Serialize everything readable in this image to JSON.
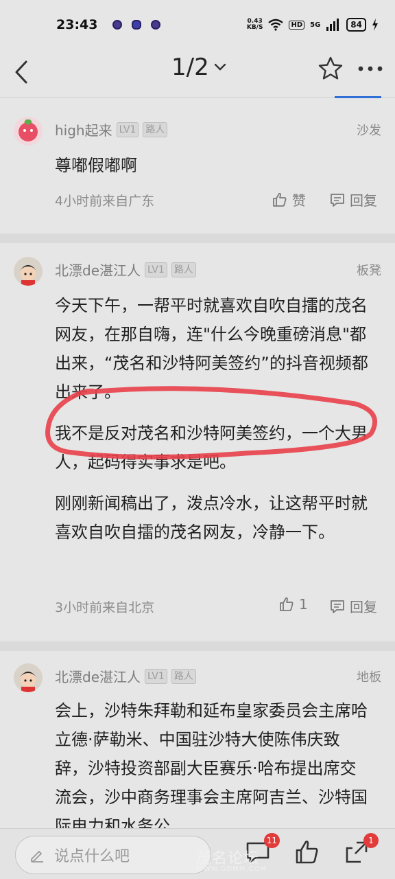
{
  "status_bar": {
    "time": "23:43",
    "net_speed_value": "0.43",
    "net_speed_unit": "KB/S",
    "hd": "HD",
    "signal": "5G",
    "battery": "84"
  },
  "nav": {
    "page_indicator": "1/2"
  },
  "comments": [
    {
      "username": "high起来",
      "level": "LV1",
      "role": "路人",
      "floor": "沙发",
      "paragraphs": [
        "尊嘟假嘟啊"
      ],
      "meta": "4小时前来自广东",
      "like_label": "赞",
      "reply_label": "回复"
    },
    {
      "username": "北漂de湛江人",
      "level": "LV1",
      "role": "路人",
      "floor": "板凳",
      "paragraphs": [
        "今天下午，一帮平时就喜欢自吹自擂的茂名网友，在那自嗨，连\"什么今晚重磅消息\"都出来，“茂名和沙特阿美签约”的抖音视频都出来了。",
        "我不是反对茂名和沙特阿美签约，一个大男人，起码得实事求是吧。",
        "刚刚新闻稿出了，泼点冷水，让这帮平时就喜欢自吹自擂的茂名网友，冷静一下。"
      ],
      "meta": "3小时前来自北京",
      "like_count": "1",
      "reply_label": "回复"
    },
    {
      "username": "北漂de湛江人",
      "level": "LV1",
      "role": "路人",
      "floor": "地板",
      "paragraphs": [
        "会上，沙特朱拜勒和延布皇家委员会主席哈立德·萨勒米、中国驻沙特大使陈伟庆致辞，沙特投资部副大臣赛乐·哈布提出席交流会，沙中商务理事会主席阿吉兰、沙特国际电力和水务公"
      ]
    }
  ],
  "bottom_bar": {
    "reply_placeholder": "说点什么吧",
    "comment_badge": "11",
    "share_badge": "1"
  },
  "watermark": {
    "text": "茂名论坛",
    "url": "WWW.GDMM.COM"
  },
  "colors": {
    "accent": "#2f6fd6",
    "annotation": "#e8404a",
    "badge": "#e23b3b"
  }
}
